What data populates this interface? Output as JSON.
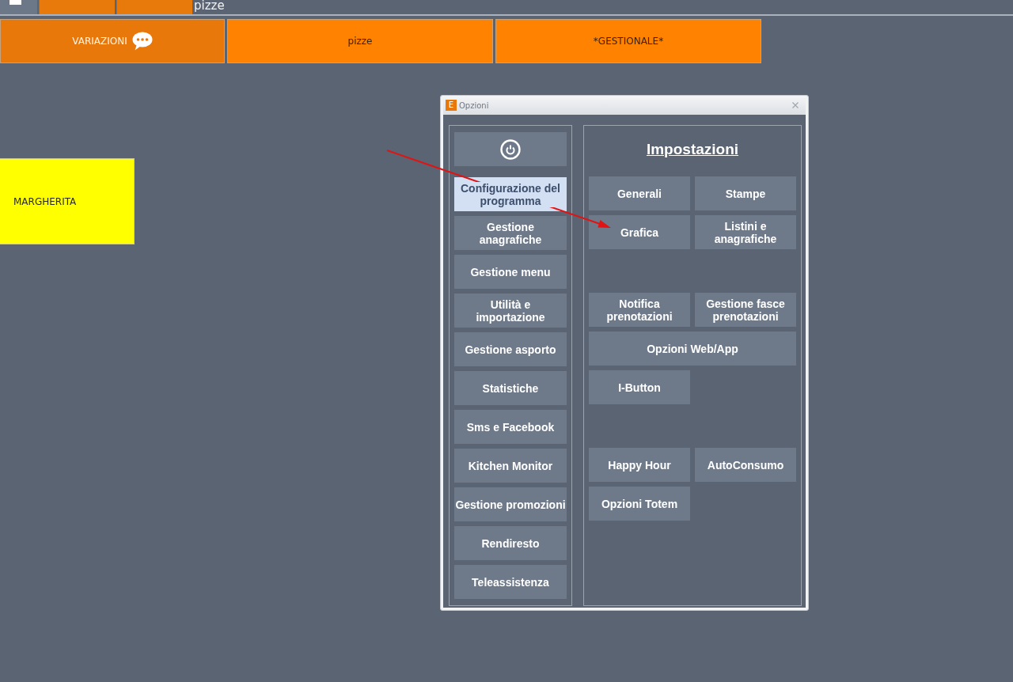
{
  "top_bar": {
    "title": "pizze"
  },
  "categories": [
    {
      "label": "VARIAZIONI",
      "kind": "variations"
    },
    {
      "label": "pizze",
      "kind": "category"
    },
    {
      "label": "*GESTIONALE*",
      "kind": "category"
    }
  ],
  "products": [
    {
      "label": "MARGHERITA",
      "color": "#ffff00"
    }
  ],
  "dialog": {
    "icon_letter": "E",
    "title": "Opzioni",
    "menu": [
      {
        "label": "Configurazione del programma",
        "selected": true
      },
      {
        "label": "Gestione anagrafiche",
        "selected": false
      },
      {
        "label": "Gestione menu",
        "selected": false
      },
      {
        "label": "Utilità e importazione",
        "selected": false
      },
      {
        "label": "Gestione asporto",
        "selected": false
      },
      {
        "label": "Statistiche",
        "selected": false
      },
      {
        "label": "Sms e Facebook",
        "selected": false
      },
      {
        "label": "Kitchen Monitor",
        "selected": false
      },
      {
        "label": "Gestione promozioni",
        "selected": false
      },
      {
        "label": "Rendiresto",
        "selected": false
      },
      {
        "label": "Teleassistenza",
        "selected": false
      }
    ],
    "settings": {
      "title": "Impostazioni",
      "groups": [
        {
          "buttons": [
            {
              "label": "Generali",
              "kind": "half"
            },
            {
              "label": "Stampe",
              "kind": "half"
            },
            {
              "label": "Grafica",
              "kind": "half"
            },
            {
              "label": "Listini e anagrafiche",
              "kind": "half"
            }
          ]
        },
        {
          "buttons": [
            {
              "label": "Notifica prenotazioni",
              "kind": "half"
            },
            {
              "label": "Gestione fasce prenotazioni",
              "kind": "half"
            },
            {
              "label": "Opzioni Web/App",
              "kind": "wide"
            },
            {
              "label": "I-Button",
              "kind": "half"
            }
          ]
        },
        {
          "buttons": [
            {
              "label": "Happy Hour",
              "kind": "half"
            },
            {
              "label": "AutoConsumo",
              "kind": "half"
            },
            {
              "label": "Opzioni Totem",
              "kind": "half"
            }
          ]
        }
      ]
    }
  }
}
